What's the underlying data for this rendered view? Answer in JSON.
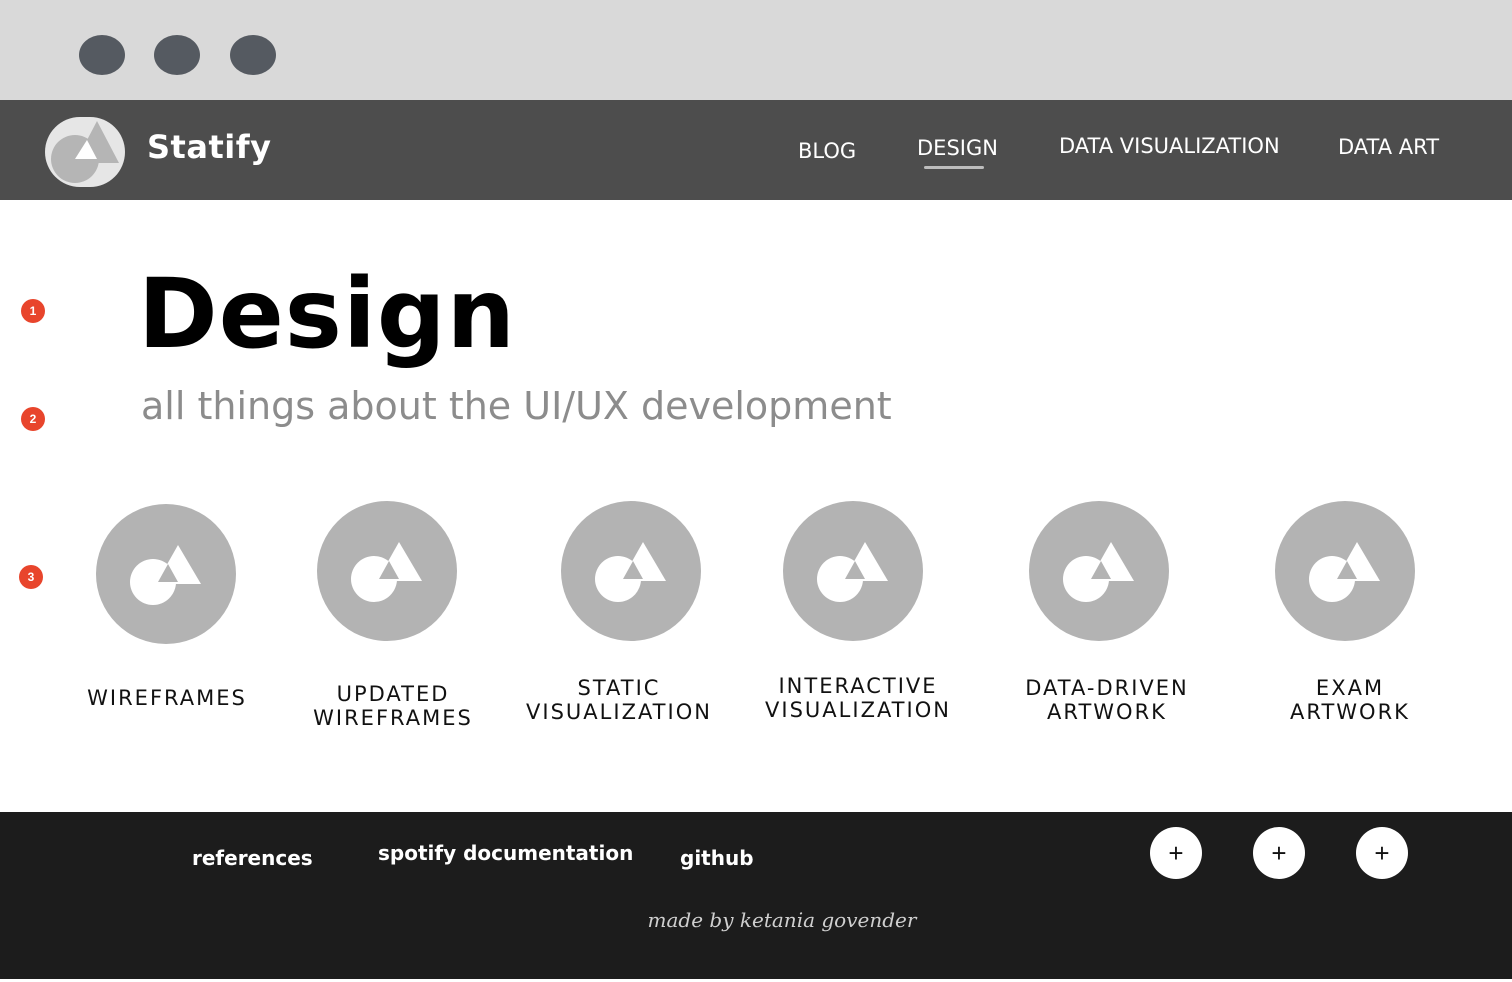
{
  "brand": {
    "name": "Statify",
    "logo_icon": "statify-logo-icon"
  },
  "nav": {
    "items": [
      {
        "label": "BLOG"
      },
      {
        "label": "DESIGN",
        "active": true
      },
      {
        "label": "DATA VISUALIZATION"
      },
      {
        "label": "DATA ART"
      }
    ]
  },
  "markers": [
    "1",
    "2",
    "3"
  ],
  "page": {
    "title": "Design",
    "subtitle": "all things about the UI/UX development"
  },
  "cards": [
    {
      "label": "WIREFRAMES",
      "icon": "statify-mark-icon"
    },
    {
      "label": "UPDATED\nWIREFRAMES",
      "icon": "statify-mark-icon"
    },
    {
      "label": "STATIC\nVISUALIZATION",
      "icon": "statify-mark-icon"
    },
    {
      "label": "INTERACTIVE\nVISUALIZATION",
      "icon": "statify-mark-icon"
    },
    {
      "label": "DATA-DRIVEN\nARTWORK",
      "icon": "statify-mark-icon"
    },
    {
      "label": "EXAM\nARTWORK",
      "icon": "statify-mark-icon"
    }
  ],
  "footer": {
    "links": [
      {
        "label": "references"
      },
      {
        "label": "spotify documentation"
      },
      {
        "label": "github"
      }
    ],
    "credit": "made by ketania govender",
    "social_buttons": [
      {
        "symbol": "+",
        "icon": "plus-icon"
      },
      {
        "symbol": "+",
        "icon": "plus-icon"
      },
      {
        "symbol": "+",
        "icon": "plus-icon"
      }
    ]
  },
  "colors": {
    "nav_bg": "#4d4d4d",
    "footer_bg": "#1c1c1c",
    "marker": "#e8452c",
    "card_circle": "#b3b3b3"
  }
}
